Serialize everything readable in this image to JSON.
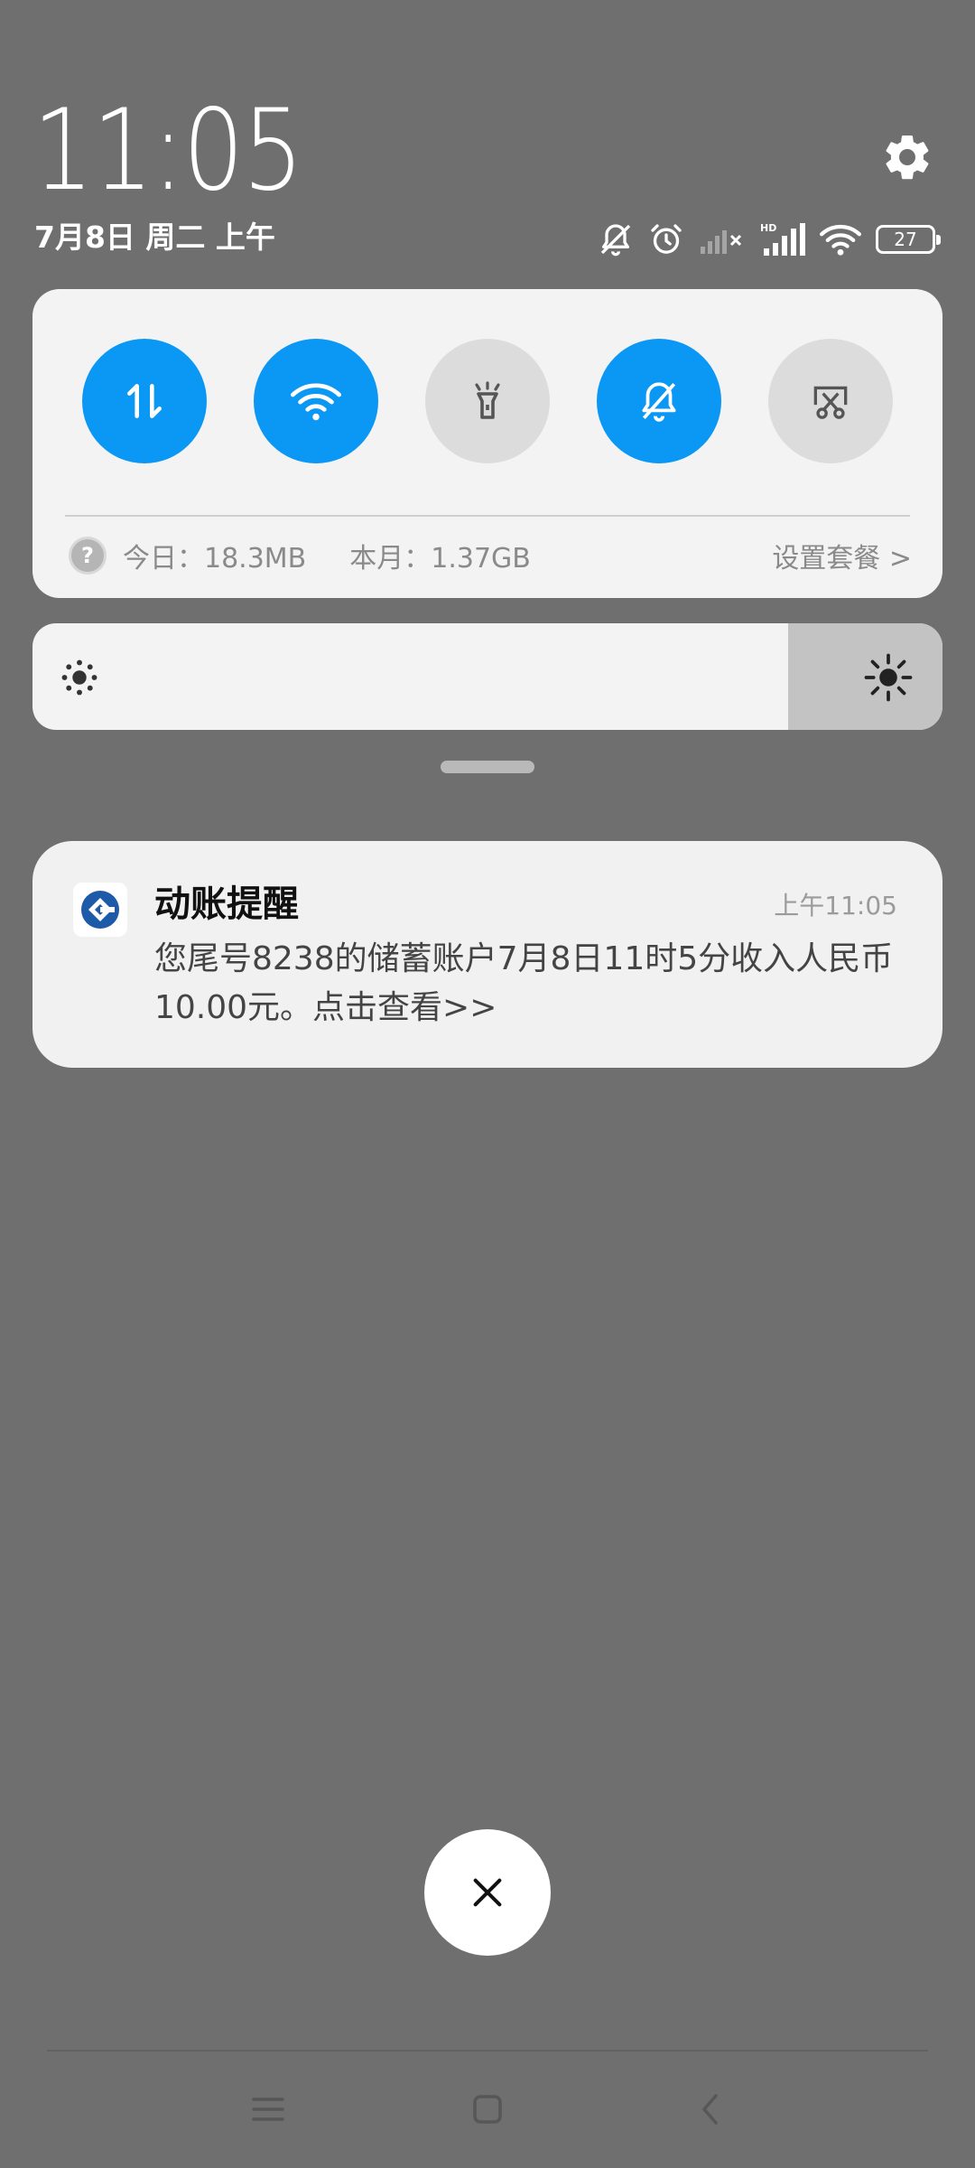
{
  "header": {
    "time": "11:05",
    "date": "7月8日 周二 上午"
  },
  "status": {
    "battery": "27",
    "network_badge": "HD"
  },
  "quick_settings": {
    "toggles": [
      {
        "name": "mobile-data",
        "icon": "data-arrows-icon",
        "on": true
      },
      {
        "name": "wifi",
        "icon": "wifi-icon",
        "on": true
      },
      {
        "name": "flashlight",
        "icon": "flashlight-icon",
        "on": false
      },
      {
        "name": "mute",
        "icon": "bell-off-icon",
        "on": true
      },
      {
        "name": "screenshot",
        "icon": "scissors-icon",
        "on": false
      }
    ],
    "usage_today": "今日：18.3MB",
    "usage_month": "本月：1.37GB",
    "set_plan": "设置套餐 >"
  },
  "brightness": {
    "level": 0.83
  },
  "notification": {
    "title": "动账提醒",
    "time": "上午11:05",
    "body": "您尾号8238的储蓄账户7月8日11时5分收入人民币10.00元。点击查看>>"
  },
  "colors": {
    "accent": "#0b97f4",
    "background": "#6f6f6f",
    "card": "#f3f3f3",
    "bank_logo": "#1d5aa8"
  }
}
